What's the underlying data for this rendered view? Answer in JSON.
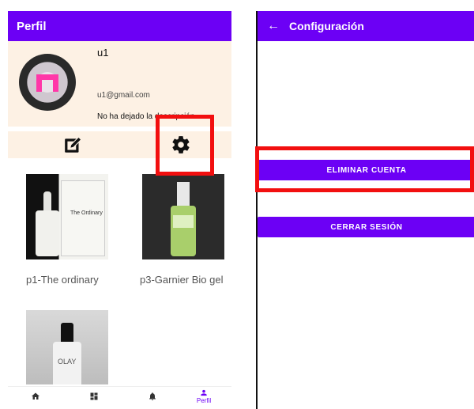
{
  "left_screen": {
    "appbar_title": "Perfil",
    "profile": {
      "username": "u1",
      "email": "u1@gmail.com",
      "description": "No ha dejado la descripción"
    },
    "actions": {
      "edit_icon": "edit-icon",
      "settings_icon": "gear-icon"
    },
    "products": [
      {
        "name": "p1-The ordinary",
        "brand": "The Ordinary"
      },
      {
        "name": "p3-Garnier Bio gel"
      },
      {
        "name": "",
        "brand": "OLAY"
      }
    ],
    "bottom_nav": [
      {
        "icon": "home-icon",
        "label": ""
      },
      {
        "icon": "dashboard-icon",
        "label": ""
      },
      {
        "icon": "bell-icon",
        "label": ""
      },
      {
        "icon": "person-icon",
        "label": "Perfil"
      }
    ]
  },
  "right_screen": {
    "appbar_title": "Configuración",
    "back_icon": "arrow-back-icon",
    "delete_account_label": "ELIMINAR CUENTA",
    "logout_label": "CERRAR SESIÓN"
  },
  "colors": {
    "primary": "#6c00f5",
    "card_bg": "#fdf1e4",
    "highlight": "#f20f0f"
  }
}
